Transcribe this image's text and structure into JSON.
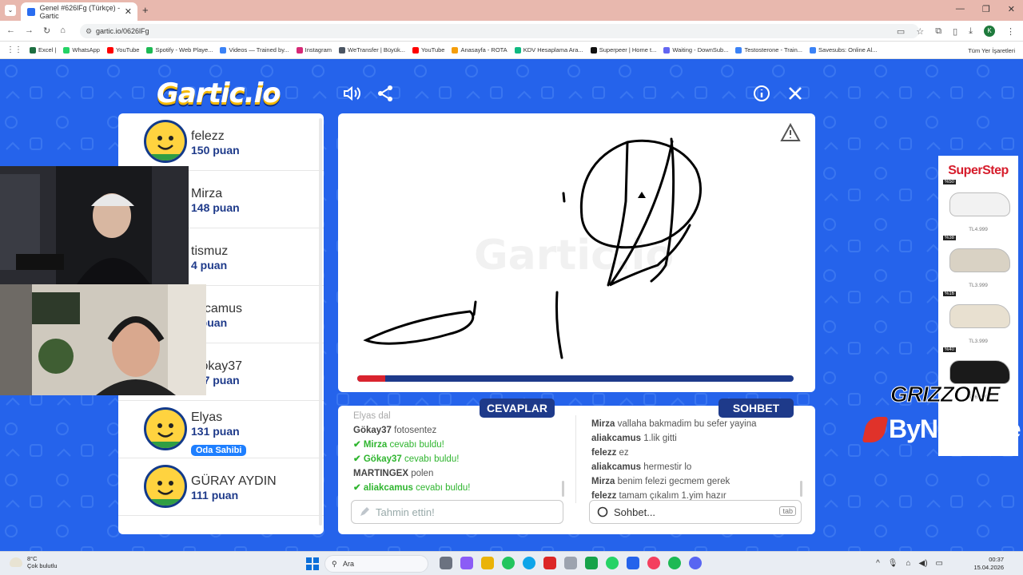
{
  "browser": {
    "tab_title": "Genel #626lFg (Türkçe) - Gartic",
    "url": "gartic.io/0626lFg",
    "bookmarks": [
      {
        "label": "Excel |",
        "color": "#1d6f42"
      },
      {
        "label": "WhatsApp",
        "color": "#25d366"
      },
      {
        "label": "YouTube",
        "color": "#ff0000"
      },
      {
        "label": "Spotify - Web Playe...",
        "color": "#1db954"
      },
      {
        "label": "Videos — Trained by...",
        "color": "#3b82f6"
      },
      {
        "label": "Instagram",
        "color": "#d62976"
      },
      {
        "label": "WeTransfer | Büyük...",
        "color": "#4b5563"
      },
      {
        "label": "YouTube",
        "color": "#ff0000"
      },
      {
        "label": "Anasayfa - ROTA",
        "color": "#f59e0b"
      },
      {
        "label": "KDV Hesaplama Ara...",
        "color": "#10b981"
      },
      {
        "label": "Superpeer | Home t...",
        "color": "#111111"
      },
      {
        "label": "Waiting - DownSub...",
        "color": "#6366f1"
      },
      {
        "label": "Testosterone - Train...",
        "color": "#3b82f6"
      },
      {
        "label": "Savesubs: Online Al...",
        "color": "#3b82f6"
      }
    ],
    "all_bookmarks": "Tüm Yer İşaretleri",
    "profile_letter": "K"
  },
  "game": {
    "logo": "Gartic.io",
    "watermark": "Gartic.io",
    "progress": 0.065,
    "players": [
      {
        "name": "felezz",
        "points": "150 puan",
        "checked": false,
        "owner": false,
        "color": "#ffd33f"
      },
      {
        "name": "Mirza",
        "points": "148 puan",
        "checked": false,
        "owner": false,
        "color": "#ffd33f"
      },
      {
        "name": "tismuz",
        "points": "4 puan",
        "checked": false,
        "owner": false,
        "color": "#ffd33f"
      },
      {
        "name": "akcamus",
        "points": "3 puan",
        "checked": false,
        "owner": false,
        "color": "#ffd33f"
      },
      {
        "name": "Gökay37",
        "points": "137 puan",
        "checked": true,
        "owner": false,
        "color": "#ffd33f"
      },
      {
        "name": "Elyas",
        "points": "131 puan",
        "checked": false,
        "owner": true,
        "color": "#ffd33f"
      },
      {
        "name": "GÜRAY AYDIN",
        "points": "111 puan",
        "checked": false,
        "owner": false,
        "color": "#ffd33f"
      }
    ],
    "owner_badge": "Oda Sahibi",
    "answers_title": "CEVAPLAR",
    "chat_title": "SOHBET",
    "answers": [
      {
        "user": "Elyas",
        "text": "dal",
        "correct": false,
        "faded": true
      },
      {
        "user": "Gökay37",
        "text": "fotosentez",
        "correct": false,
        "faded": false
      },
      {
        "user": "Mirza",
        "text": "cevabı buldu!",
        "correct": true,
        "faded": false
      },
      {
        "user": "Gökay37",
        "text": "cevabı buldu!",
        "correct": true,
        "faded": false
      },
      {
        "user": "MARTINGEX",
        "text": "polen",
        "correct": false,
        "faded": false
      },
      {
        "user": "aliakcamus",
        "text": "cevabı buldu!",
        "correct": true,
        "faded": false
      }
    ],
    "chat": [
      {
        "user": "Mirza",
        "text": "vallaha bakmadim bu sefer yayina"
      },
      {
        "user": "aliakcamus",
        "text": "1.lik gitti"
      },
      {
        "user": "felezz",
        "text": "ez"
      },
      {
        "user": "aliakcamus",
        "text": "hermestir lo"
      },
      {
        "user": "Mirza",
        "text": "benim felezi gecmem gerek"
      },
      {
        "user": "felezz",
        "text": "tamam çıkalım 1.yim hazır"
      }
    ],
    "guess_placeholder": "Tahmin ettin!",
    "chat_placeholder": "Sohbet...",
    "tab_key": "tab"
  },
  "overlay": {
    "ad_brand": "SuperStep",
    "ad_items": [
      {
        "discount": "%50",
        "price": "TL4.999",
        "color": "#f2f2f2"
      },
      {
        "discount": "%38",
        "price": "TL3.999",
        "color": "#d9d2c4"
      },
      {
        "discount": "%16",
        "price": "TL3.999",
        "color": "#e8e0d0"
      },
      {
        "discount": "%40",
        "price": "TL6.819",
        "color": "#1a1a1a"
      }
    ],
    "grizzone": "GRIZZONE",
    "bynogame": "ByNoGame"
  },
  "taskbar": {
    "temp": "8°C",
    "weather": "Çok bulutlu",
    "search": "Ara",
    "time": "00:37",
    "date": "15.04.2026"
  }
}
